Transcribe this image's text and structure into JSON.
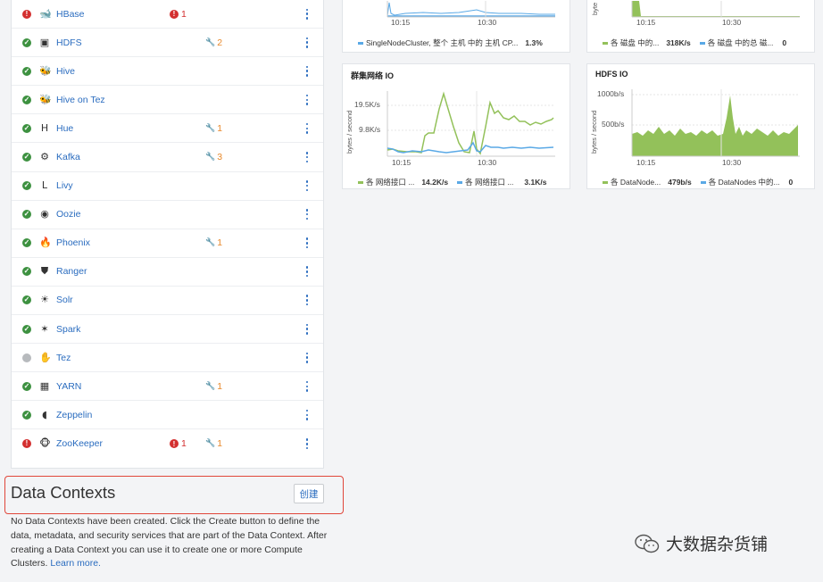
{
  "services": [
    {
      "name": "HBase",
      "status": "bad",
      "icon": "hbase-icon",
      "glyph": "🐋",
      "alerts": "1",
      "config": ""
    },
    {
      "name": "HDFS",
      "status": "good",
      "icon": "hdfs-icon",
      "glyph": "▣",
      "alerts": "",
      "config": "2"
    },
    {
      "name": "Hive",
      "status": "good",
      "icon": "hive-icon",
      "glyph": "🐝",
      "alerts": "",
      "config": ""
    },
    {
      "name": "Hive on Tez",
      "status": "good",
      "icon": "hive-on-tez-icon",
      "glyph": "🐝",
      "alerts": "",
      "config": ""
    },
    {
      "name": "Hue",
      "status": "good",
      "icon": "hue-icon",
      "glyph": "H",
      "alerts": "",
      "config": "1"
    },
    {
      "name": "Kafka",
      "status": "good",
      "icon": "kafka-icon",
      "glyph": "⚙",
      "alerts": "",
      "config": "3"
    },
    {
      "name": "Livy",
      "status": "good",
      "icon": "livy-icon",
      "glyph": "L",
      "alerts": "",
      "config": ""
    },
    {
      "name": "Oozie",
      "status": "good",
      "icon": "oozie-icon",
      "glyph": "◉",
      "alerts": "",
      "config": ""
    },
    {
      "name": "Phoenix",
      "status": "good",
      "icon": "phoenix-icon",
      "glyph": "🔥",
      "alerts": "",
      "config": "1"
    },
    {
      "name": "Ranger",
      "status": "good",
      "icon": "ranger-icon",
      "glyph": "⛊",
      "alerts": "",
      "config": ""
    },
    {
      "name": "Solr",
      "status": "good",
      "icon": "solr-icon",
      "glyph": "☀",
      "alerts": "",
      "config": ""
    },
    {
      "name": "Spark",
      "status": "good",
      "icon": "spark-icon",
      "glyph": "✶",
      "alerts": "",
      "config": ""
    },
    {
      "name": "Tez",
      "status": "none",
      "icon": "tez-icon",
      "glyph": "✋",
      "alerts": "",
      "config": ""
    },
    {
      "name": "YARN",
      "status": "good",
      "icon": "yarn-icon",
      "glyph": "▦",
      "alerts": "",
      "config": "1"
    },
    {
      "name": "Zeppelin",
      "status": "good",
      "icon": "zeppelin-icon",
      "glyph": "◖",
      "alerts": "",
      "config": ""
    },
    {
      "name": "ZooKeeper",
      "status": "bad",
      "icon": "zookeeper-icon",
      "glyph": "🐵",
      "alerts": "1",
      "config": "1"
    }
  ],
  "colors": {
    "link": "#2a6cbf",
    "good": "#3d9140",
    "bad": "#d32f2f",
    "none": "#b7babd",
    "config": "#e8892b",
    "green_series": "#93c15a",
    "blue_series": "#5aa9e6",
    "highlight": "#e0463a"
  },
  "data_contexts": {
    "title": "Data Contexts",
    "create_label": "创建",
    "description": "No Data Contexts have been created. Click the Create button to define the data, metadata, and security services that are part of the Data Context. After creating a Data Context you can use it to create one or more Compute Clusters.",
    "learn_more": "Learn more."
  },
  "charts": {
    "cpu": {
      "x_ticks": [
        "10:15",
        "10:30"
      ],
      "legend": [
        {
          "label": "SingleNodeCluster, 整个 主机 中的 主机 CP...",
          "value": "1.3%",
          "color": "#5aa9e6"
        }
      ]
    },
    "disk": {
      "ylabel": "byte",
      "x_ticks": [
        "10:15",
        "10:30"
      ],
      "legend": [
        {
          "label": "各 磁盘 中的...",
          "value": "318K/s",
          "color": "#93c15a"
        },
        {
          "label": "各 磁盘 中的总 磁...",
          "value": "0",
          "color": "#5aa9e6"
        }
      ]
    },
    "network": {
      "title": "群集网络 IO",
      "ylabel": "bytes / second",
      "y_ticks": [
        "19.5K/s",
        "9.8K/s"
      ],
      "x_ticks": [
        "10:15",
        "10:30"
      ],
      "legend": [
        {
          "label": "各 网络接口 ...",
          "value": "14.2K/s",
          "color": "#93c15a"
        },
        {
          "label": "各 网络接口 ...",
          "value": "3.1K/s",
          "color": "#5aa9e6"
        }
      ]
    },
    "hdfs": {
      "title": "HDFS IO",
      "ylabel": "bytes / second",
      "y_ticks": [
        "1000b/s",
        "500b/s"
      ],
      "x_ticks": [
        "10:15",
        "10:30"
      ],
      "legend": [
        {
          "label": "各 DataNode...",
          "value": "479b/s",
          "color": "#93c15a"
        },
        {
          "label": "各 DataNodes 中的...",
          "value": "0",
          "color": "#5aa9e6"
        }
      ]
    }
  },
  "watermark": "大数据杂货铺"
}
